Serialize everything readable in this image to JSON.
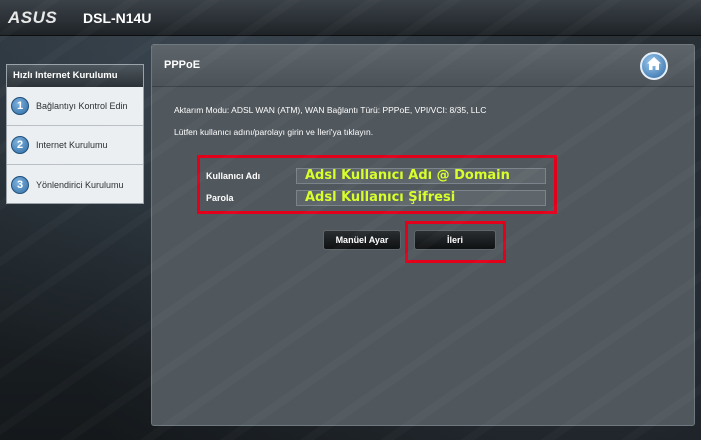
{
  "header": {
    "brand": "ASUS",
    "model": "DSL-N14U"
  },
  "sidebar": {
    "title": "Hızlı Internet Kurulumu",
    "steps": [
      {
        "num": "1",
        "label": "Bağlantıyı Kontrol Edin"
      },
      {
        "num": "2",
        "label": "Internet Kurulumu"
      },
      {
        "num": "3",
        "label": "Yönlendirici Kurulumu"
      }
    ]
  },
  "panel": {
    "title": "PPPoE",
    "info_line": "Aktarım Modu: ADSL WAN (ATM), WAN Bağlantı Türü: PPPoE, VPI/VCI: 8/35, LLC",
    "instruction": "Lütfen kullanıcı adını/parolayı girin ve İleri'ya tıklayın.",
    "username_label": "Kullanıcı Adı",
    "username_value": "Adsl Kullanıcı Adı @ Domain",
    "password_label": "Parola",
    "password_value": "Adsl Kullanıcı Şifresi",
    "manual_button": "Manüel Ayar",
    "next_button": "İleri"
  },
  "colors": {
    "highlight": "#e3001b",
    "input_text": "#d8ff2a",
    "accent_blue": "#2c6aa3"
  },
  "icons": {
    "home": "home-icon"
  }
}
